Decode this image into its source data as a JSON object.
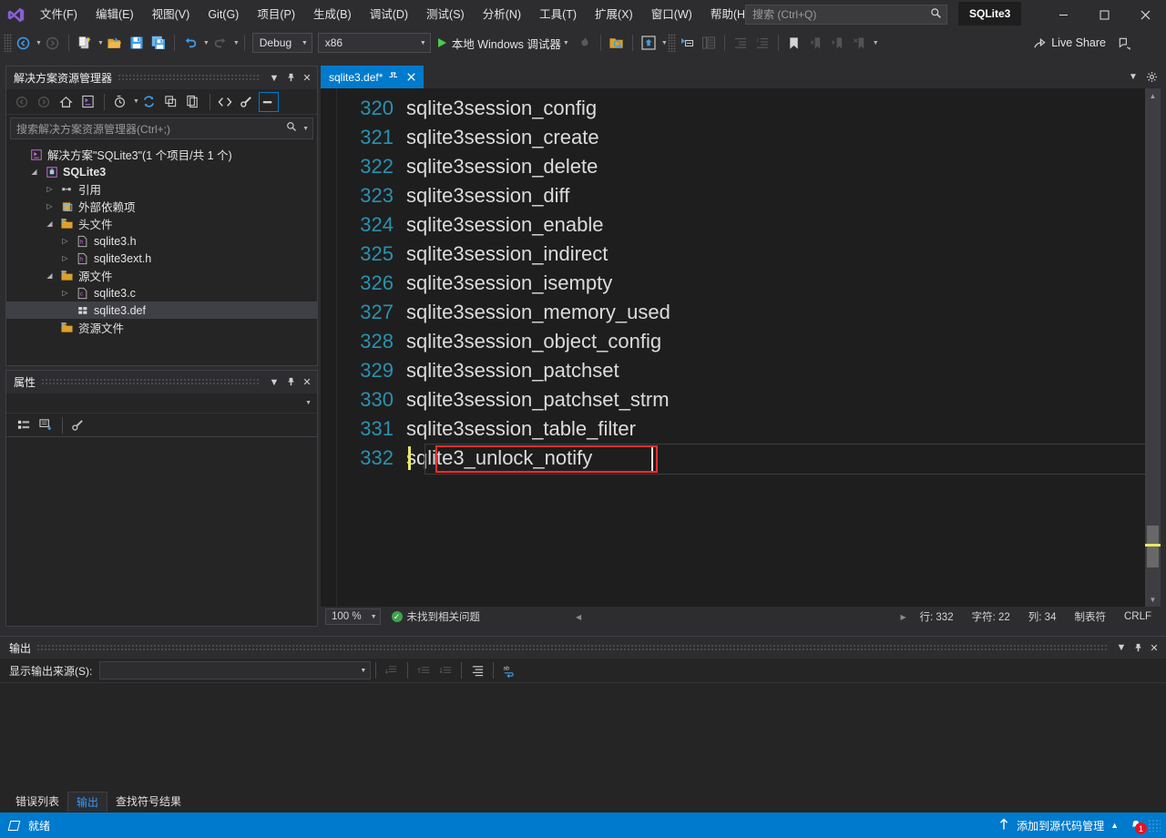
{
  "app": {
    "project_badge": "SQLite3",
    "logo_icon": "visual-studio-logo-icon"
  },
  "menu": {
    "items": [
      {
        "label": "文件(F)"
      },
      {
        "label": "编辑(E)"
      },
      {
        "label": "视图(V)"
      },
      {
        "label": "Git(G)"
      },
      {
        "label": "项目(P)"
      },
      {
        "label": "生成(B)"
      },
      {
        "label": "调试(D)"
      },
      {
        "label": "测试(S)"
      },
      {
        "label": "分析(N)"
      },
      {
        "label": "工具(T)"
      },
      {
        "label": "扩展(X)"
      },
      {
        "label": "窗口(W)"
      },
      {
        "label": "帮助(H)"
      }
    ]
  },
  "search": {
    "placeholder": "搜索 (Ctrl+Q)",
    "value": "",
    "icon": "search-icon"
  },
  "window_controls": {
    "minimize": "—",
    "maximize": "☐",
    "close": "✕"
  },
  "toolbar": {
    "back_label": "←",
    "forward_label": "→",
    "new_item_label": "new-item",
    "open_label": "open-file",
    "save_label": "save",
    "save_all_label": "save-all",
    "undo_label": "↶",
    "redo_label": "↷",
    "config_combo": {
      "value": "Debug"
    },
    "platform_combo": {
      "value": "x86"
    },
    "run_label": "本地 Windows 调试器",
    "live_share_label": "Live Share"
  },
  "solution_explorer": {
    "title": "解决方案资源管理器",
    "search_placeholder": "搜索解决方案资源管理器(Ctrl+;)",
    "toolbar_icons": [
      "back-icon",
      "forward-icon",
      "home-icon",
      "solution-icon",
      "pending-changes-icon",
      "refresh-icon",
      "collapse-all-icon",
      "show-all-files-icon",
      "view-code-icon",
      "properties-icon",
      "preview-icon"
    ],
    "tree": [
      {
        "label": "解决方案\"SQLite3\"(1 个项目/共 1 个)",
        "indent": 0,
        "twisty": "",
        "icon": "solution-icon",
        "bold": false,
        "selected": false
      },
      {
        "label": "SQLite3",
        "indent": 1,
        "twisty": "▼",
        "icon": "project-icon",
        "bold": true,
        "selected": false
      },
      {
        "label": "引用",
        "indent": 2,
        "twisty": "▶",
        "icon": "references-icon",
        "bold": false,
        "selected": false
      },
      {
        "label": "外部依赖项",
        "indent": 2,
        "twisty": "▶",
        "icon": "external-deps-icon",
        "bold": false,
        "selected": false
      },
      {
        "label": "头文件",
        "indent": 2,
        "twisty": "▼",
        "icon": "folder-filter-icon",
        "bold": false,
        "selected": false
      },
      {
        "label": "sqlite3.h",
        "indent": 3,
        "twisty": "▶",
        "icon": "header-file-icon",
        "bold": false,
        "selected": false
      },
      {
        "label": "sqlite3ext.h",
        "indent": 3,
        "twisty": "▶",
        "icon": "header-file-icon",
        "bold": false,
        "selected": false
      },
      {
        "label": "源文件",
        "indent": 2,
        "twisty": "▼",
        "icon": "folder-filter-icon",
        "bold": false,
        "selected": false
      },
      {
        "label": "sqlite3.c",
        "indent": 3,
        "twisty": "▶",
        "icon": "c-file-icon",
        "bold": false,
        "selected": false
      },
      {
        "label": "sqlite3.def",
        "indent": 3,
        "twisty": "",
        "icon": "def-file-icon",
        "bold": false,
        "selected": true
      },
      {
        "label": "资源文件",
        "indent": 2,
        "twisty": "",
        "icon": "folder-filter-icon",
        "bold": false,
        "selected": false
      }
    ]
  },
  "properties": {
    "title": "属性",
    "toolbar_icons": [
      "categorized-icon",
      "alphabetical-icon",
      "property-pages-icon"
    ],
    "selected_object": ""
  },
  "editor": {
    "tab": {
      "label": "sqlite3.def*",
      "pin_icon": "pin-icon",
      "close_icon": "close-icon"
    },
    "tab_right_icons": [
      "chevron-down-icon",
      "gear-icon"
    ],
    "lines": [
      {
        "number": "320",
        "text": "sqlite3session_config"
      },
      {
        "number": "321",
        "text": "sqlite3session_create"
      },
      {
        "number": "322",
        "text": "sqlite3session_delete"
      },
      {
        "number": "323",
        "text": "sqlite3session_diff"
      },
      {
        "number": "324",
        "text": "sqlite3session_enable"
      },
      {
        "number": "325",
        "text": "sqlite3session_indirect"
      },
      {
        "number": "326",
        "text": "sqlite3session_isempty"
      },
      {
        "number": "327",
        "text": "sqlite3session_memory_used"
      },
      {
        "number": "328",
        "text": "sqlite3session_object_config"
      },
      {
        "number": "329",
        "text": "sqlite3session_patchset"
      },
      {
        "number": "330",
        "text": "sqlite3session_patchset_strm"
      },
      {
        "number": "331",
        "text": "sqlite3session_table_filter"
      },
      {
        "number": "332",
        "text": "sqlite3_unlock_notify"
      }
    ],
    "highlight_line_index": 12,
    "highlight_color": "#ff2d2d",
    "status": {
      "zoom": "100 %",
      "issues": "未找到相关问题",
      "line": "行: 332",
      "char": "字符: 22",
      "column": "列: 34",
      "indent": "制表符",
      "eol": "CRLF"
    }
  },
  "output": {
    "title": "输出",
    "source_label": "显示输出来源(S):",
    "source_value": "",
    "body_text": "",
    "toolbar_icons": [
      "goto-message-icon",
      "prev-message-icon",
      "next-message-icon",
      "clear-all-icon",
      "word-wrap-icon"
    ]
  },
  "bottom_tabs": [
    {
      "label": "错误列表",
      "active": false
    },
    {
      "label": "输出",
      "active": true
    },
    {
      "label": "查找符号结果",
      "active": false
    }
  ],
  "status_bar": {
    "ready": "就绪",
    "source_control": "添加到源代码管理",
    "source_control_caret": "▲",
    "upload_icon": "upload-arrow-icon",
    "bell_icon": "notification-bell-icon",
    "bell_count": "1"
  }
}
